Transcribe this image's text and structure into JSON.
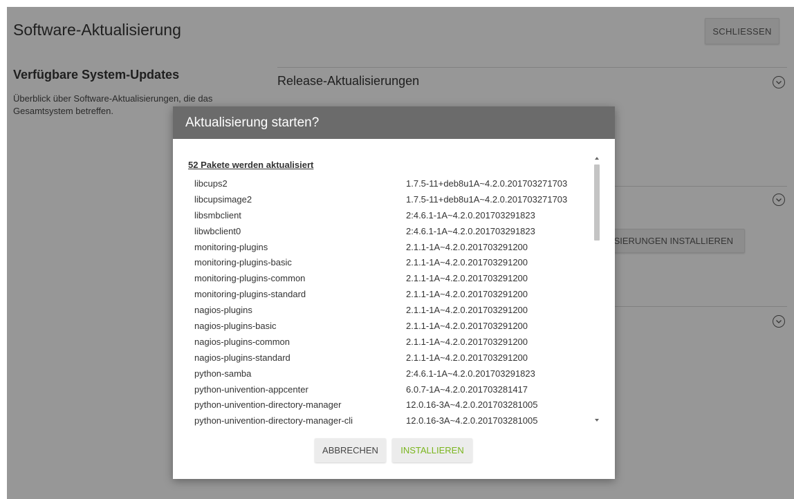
{
  "app": {
    "title": "Software-Aktualisierung",
    "close_label": "SCHLIESSEN"
  },
  "sidebar": {
    "title": "Verfügbare System-Updates",
    "description": "Überblick über Software-Aktualisierungen, die das Gesamtsystem betreffen."
  },
  "main": {
    "release_section_title": "Release-Aktualisierungen",
    "install_updates_button_label": "AKTUALISIERUNGEN INSTALLIEREN"
  },
  "dialog": {
    "title": "Aktualisierung starten?",
    "list_heading": "52 Pakete werden aktualisiert",
    "packages": [
      {
        "name": "libcups2",
        "version": "1.7.5-11+deb8u1A~4.2.0.201703271703"
      },
      {
        "name": "libcupsimage2",
        "version": "1.7.5-11+deb8u1A~4.2.0.201703271703"
      },
      {
        "name": "libsmbclient",
        "version": "2:4.6.1-1A~4.2.0.201703291823"
      },
      {
        "name": "libwbclient0",
        "version": "2:4.6.1-1A~4.2.0.201703291823"
      },
      {
        "name": "monitoring-plugins",
        "version": "2.1.1-1A~4.2.0.201703291200"
      },
      {
        "name": "monitoring-plugins-basic",
        "version": "2.1.1-1A~4.2.0.201703291200"
      },
      {
        "name": "monitoring-plugins-common",
        "version": "2.1.1-1A~4.2.0.201703291200"
      },
      {
        "name": "monitoring-plugins-standard",
        "version": "2.1.1-1A~4.2.0.201703291200"
      },
      {
        "name": "nagios-plugins",
        "version": "2.1.1-1A~4.2.0.201703291200"
      },
      {
        "name": "nagios-plugins-basic",
        "version": "2.1.1-1A~4.2.0.201703291200"
      },
      {
        "name": "nagios-plugins-common",
        "version": "2.1.1-1A~4.2.0.201703291200"
      },
      {
        "name": "nagios-plugins-standard",
        "version": "2.1.1-1A~4.2.0.201703291200"
      },
      {
        "name": "python-samba",
        "version": "2:4.6.1-1A~4.2.0.201703291823"
      },
      {
        "name": "python-univention-appcenter",
        "version": "6.0.7-1A~4.2.0.201703281417"
      },
      {
        "name": "python-univention-directory-manager",
        "version": "12.0.16-3A~4.2.0.201703281005"
      },
      {
        "name": "python-univention-directory-manager-cli",
        "version": "12.0.16-3A~4.2.0.201703281005"
      }
    ],
    "cancel_label": "ABBRECHEN",
    "install_label": "INSTALLIEREN"
  },
  "colors": {
    "accent_green": "#7ab51d",
    "dialog_header": "#6b6b6b",
    "overlay": "rgba(0,0,0,0.38)"
  }
}
